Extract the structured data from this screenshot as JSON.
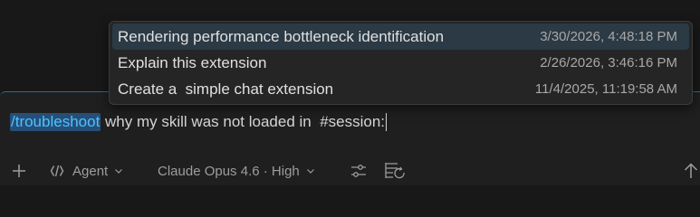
{
  "history": {
    "items": [
      {
        "title": "Rendering performance bottleneck identification",
        "date": "3/30/2026, 4:48:18 PM",
        "selected": true
      },
      {
        "title": "Explain this extension",
        "date": "2/26/2026, 3:46:16 PM",
        "selected": false
      },
      {
        "title": "Create a  simple chat extension",
        "date": "11/4/2025, 11:19:58 AM",
        "selected": false
      }
    ]
  },
  "input": {
    "command": "/troubleshoot",
    "text": " why my skill was not loaded in  ",
    "context_ref": "#session:"
  },
  "toolbar": {
    "add_icon": "plus-icon",
    "mode_icon": "agent-icon",
    "mode_label": "Agent",
    "model_label": "Claude Opus 4.6 · High",
    "configure_icon": "sliders-icon",
    "tools_icon": "tools-list-icon",
    "send_icon": "arrow-up-icon"
  },
  "colors": {
    "background": "#181818",
    "panel": "#1f1f1f",
    "popup": "#252526",
    "popup_selected": "#2b3a45",
    "command_highlight": "#264f78",
    "command_text": "#4fc1ff",
    "focus_border": "#2b6a96"
  }
}
